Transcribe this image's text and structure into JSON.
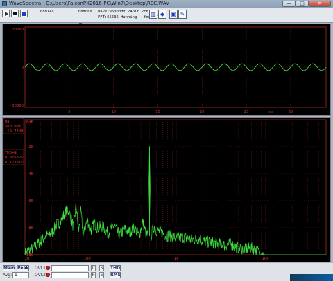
{
  "window": {
    "title": "WaveSpectra - C:\\Users\\FalconPX2016-PC\\Win7\\Desktop\\REC.WAV",
    "min": "—",
    "max": "□",
    "close": "✕"
  },
  "toolbar": {
    "time_elapsed": "08m14s",
    "time_total": "08m06s",
    "wave_info": "Wave:96000Hz 24bit 2ch",
    "fft_info": "FFT:65536 Hanning",
    "fps": "fest:170",
    "icons": [
      "spectrum-icon",
      "scope-icon",
      "settings-icon",
      "wrench-icon"
    ]
  },
  "scope": {
    "y_labels": [
      "30000",
      "0",
      "-30000"
    ],
    "x_labels": [
      "5",
      "10",
      "15",
      "20",
      "25",
      "ms",
      "30"
    ]
  },
  "spectrum": {
    "db_label": "0dB",
    "y_labels": [
      "-20",
      "-40",
      "-60",
      "-80",
      "-100"
    ],
    "x_labels": [
      "20",
      "100",
      "1k",
      "10k"
    ],
    "readout_label": "Ma",
    "readout_freq": "500.0Hz",
    "readout_level": "-19.73dB",
    "thd_label": "THD+N",
    "thd_l": "0.07632%",
    "thd_r": "0.12381%"
  },
  "chart_data": [
    {
      "type": "line",
      "title": "",
      "y_ticks": [
        30000,
        0,
        -30000
      ],
      "ylim": [
        -30000,
        30000
      ],
      "x_ticks": [
        5,
        10,
        15,
        20,
        25,
        30
      ],
      "xlabel": "ms",
      "xlim": [
        0,
        34
      ],
      "series": [
        {
          "values_desc": "",
          "amplitude": 2500,
          "cycles": 17
        }
      ],
      "grid": true
    },
    {
      "type": "line",
      "x_scale": "log",
      "xlim": [
        20,
        48000
      ],
      "ylim": [
        -100,
        0
      ],
      "x_ticks": [
        20,
        100,
        1000,
        10000
      ],
      "y_ticks": [
        0,
        -20,
        -40,
        -60,
        -80,
        -100
      ],
      "peak": {
        "x": 500,
        "y": -19.73
      },
      "series": [
        {
          "x": [
            20,
            25,
            30,
            35,
            40,
            45,
            50,
            55,
            60,
            65,
            70,
            75,
            80,
            85,
            90,
            100,
            110,
            120,
            130,
            150,
            170,
            200,
            230,
            260,
            300,
            340,
            380,
            420,
            460,
            480,
            500,
            520,
            560,
            600,
            700,
            800,
            900,
            1000,
            1200,
            1500,
            1800,
            2000,
            2500,
            3000,
            3500,
            4000,
            5000,
            6000,
            7000,
            8000,
            9000,
            10000,
            12000,
            15000,
            20000,
            25000,
            30000,
            40000,
            48000
          ],
          "y": [
            -99,
            -95,
            -90,
            -86,
            -84,
            -78,
            -76,
            -70,
            -66,
            -72,
            -80,
            -63,
            -83,
            -68,
            -86,
            -74,
            -82,
            -77,
            -80,
            -79,
            -84,
            -78,
            -86,
            -81,
            -83,
            -80,
            -86,
            -76,
            -85,
            -86,
            -20,
            -86,
            -79,
            -82,
            -84,
            -86,
            -86,
            -88,
            -87,
            -89,
            -88,
            -90,
            -91,
            -92,
            -93,
            -92,
            -95,
            -96,
            -95,
            -97,
            -99,
            -100,
            -100,
            -100,
            -100,
            -100,
            -100,
            -100,
            -100
          ]
        }
      ],
      "grid": true
    }
  ],
  "bottom": {
    "main": "Main",
    "peak": "Peak",
    "avg_label": "Avg:",
    "avg_value": "1",
    "ovl1": "OVL1",
    "ovl2": "OVL2",
    "thd": "THD",
    "rms": "RMS",
    "l": "L",
    "r": "R"
  }
}
